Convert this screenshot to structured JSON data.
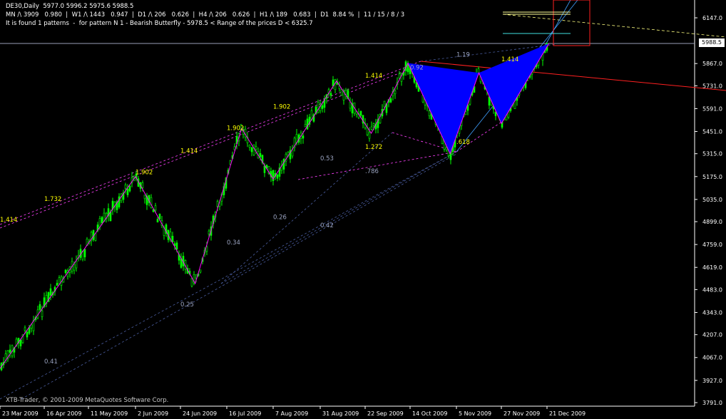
{
  "header": {
    "line1": "DE30,Daily  5977.0 5996.2 5975.6 5988.5",
    "line2": "MN /\\ 3909   0.980  |  W1 /\\ 1443   0.947  |  D1 /\\ 206   0.626  |  H4 /\\ 206   0.626  |  H1 /\\ 189   0.683  |  D1  8.84 %  |  11 / 15 / 8 / 3",
    "line3": "It is found 1 patterns  -  for pattern N 1 - Bearish Butterfly - 5978.5 < Range of the prices D < 6325.7"
  },
  "copyright": "XTB-Trader, © 2001-2009 MetaQuotes Software Corp.",
  "current_price": "5988.5",
  "colors": {
    "background": "#000000",
    "candles": "#00ff00",
    "zigzag": "#ff00ff",
    "pattern_fill": "#0000ff",
    "ratio_labels_yellow": "#ffff00",
    "ratio_labels_gray": "#9aa3c0",
    "trend_red": "#ff2020",
    "trend_yellow": "#ffff80",
    "axis_text": "#ffffff"
  },
  "chart_data": {
    "type": "candlestick",
    "instrument": "DE30",
    "timeframe": "Daily",
    "y_ticks": [
      "6147.0",
      "5988.5",
      "5867.0",
      "5731.0",
      "5591.0",
      "5451.0",
      "5315.0",
      "5175.0",
      "5035.0",
      "4899.0",
      "4759.0",
      "4619.0",
      "4483.0",
      "4343.0",
      "4207.0",
      "4067.0",
      "3927.0",
      "3791.0"
    ],
    "x_ticks": [
      "23 Mar 2009",
      "16 Apr 2009",
      "11 May 2009",
      "2 Jun 2009",
      "24 Jun 2009",
      "16 Jul 2009",
      "7 Aug 2009",
      "31 Aug 2009",
      "22 Sep 2009",
      "14 Oct 2009",
      "5 Nov 2009",
      "27 Nov 2009",
      "21 Dec 2009"
    ],
    "ylim": [
      3791,
      6250
    ],
    "zigzag_pivots": [
      {
        "date": "23 Mar 2009",
        "price": 4000
      },
      {
        "date": "2 Jun 2009",
        "price": 5175
      },
      {
        "date": "1 Jul 2009",
        "price": 4520
      },
      {
        "date": "23 Jul 2009",
        "price": 5470
      },
      {
        "date": "7 Aug 2009",
        "price": 5160
      },
      {
        "date": "8 Sep 2009",
        "price": 5760
      },
      {
        "date": "25 Sep 2009",
        "price": 5440
      },
      {
        "date": "13 Oct 2009",
        "price": 5870
      },
      {
        "date": "2 Nov 2009",
        "price": 5315
      },
      {
        "date": "16 Nov 2009",
        "price": 5810
      },
      {
        "date": "27 Nov 2009",
        "price": 5500
      },
      {
        "date": "22 Dec 2009",
        "price": 5990
      }
    ],
    "pattern": "Bearish Butterfly",
    "annotations": [
      {
        "text": "1.414",
        "date": "23 Mar 2009",
        "price": 4900,
        "color": "yellow"
      },
      {
        "text": "1.732",
        "date": "16 Apr 2009",
        "price": 5025,
        "color": "yellow"
      },
      {
        "text": "1.902",
        "date": "2 Jun 2009",
        "price": 5190,
        "color": "yellow"
      },
      {
        "text": "1.414",
        "date": "24 Jun 2009",
        "price": 5320,
        "color": "yellow"
      },
      {
        "text": "1.902",
        "date": "16 Jul 2009",
        "price": 5460,
        "color": "yellow"
      },
      {
        "text": "1.902",
        "date": "7 Aug 2009",
        "price": 5590,
        "color": "yellow"
      },
      {
        "text": "1.414",
        "date": "22 Sep 2009",
        "price": 5780,
        "color": "yellow"
      },
      {
        "text": "1.272",
        "date": "22 Sep 2009",
        "price": 5345,
        "color": "yellow"
      },
      {
        "text": ".618",
        "date": "5 Nov 2009",
        "price": 5375,
        "color": "yellow"
      },
      {
        "text": "1.414",
        "date": "27 Nov 2009",
        "price": 5880,
        "color": "yellow"
      },
      {
        "text": "1.19",
        "date": "5 Nov 2009",
        "price": 5910,
        "color": "gray"
      },
      {
        "text": "0.92",
        "date": "14 Oct 2009",
        "price": 5830,
        "color": "gray"
      },
      {
        "text": "0.53",
        "date": "31 Aug 2009",
        "price": 5275,
        "color": "gray"
      },
      {
        "text": ".786",
        "date": "22 Sep 2009",
        "price": 5195,
        "color": "gray"
      },
      {
        "text": "0.26",
        "date": "7 Aug 2009",
        "price": 4915,
        "color": "gray"
      },
      {
        "text": "0.42",
        "date": "31 Aug 2009",
        "price": 4865,
        "color": "gray"
      },
      {
        "text": "0.34",
        "date": "16 Jul 2009",
        "price": 4760,
        "color": "gray"
      },
      {
        "text": "0.25",
        "date": "24 Jun 2009",
        "price": 4380,
        "color": "gray"
      },
      {
        "text": "0.41",
        "date": "16 Apr 2009",
        "price": 4030,
        "color": "gray"
      }
    ]
  }
}
